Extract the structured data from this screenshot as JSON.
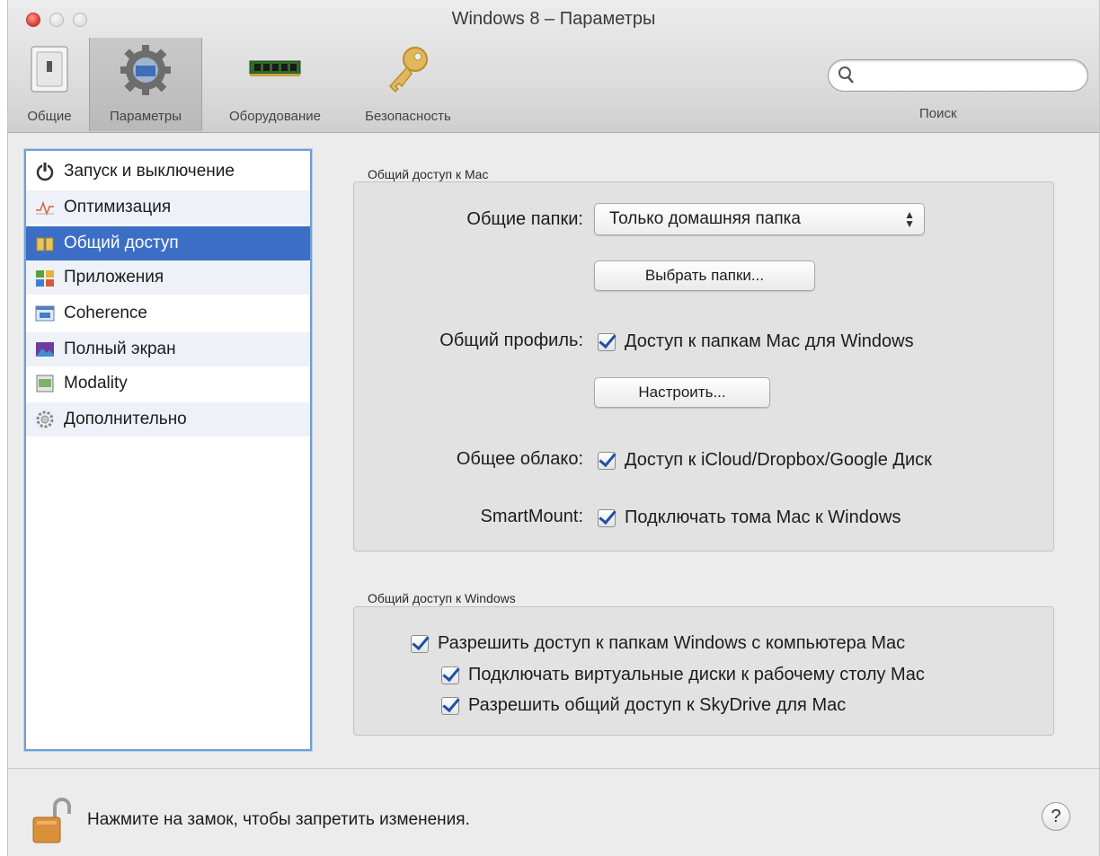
{
  "window": {
    "title": "Windows 8 – Параметры"
  },
  "toolbar": {
    "items": [
      {
        "label": "Общие",
        "icon": "general-switch-icon"
      },
      {
        "label": "Параметры",
        "icon": "gear-icon",
        "selected": true
      },
      {
        "label": "Оборудование",
        "icon": "memory-chip-icon"
      },
      {
        "label": "Безопасность",
        "icon": "key-icon"
      }
    ],
    "search": {
      "label": "Поиск",
      "placeholder": "",
      "value": ""
    }
  },
  "sidebar": {
    "items": [
      {
        "label": "Запуск и выключение",
        "icon": "power-icon"
      },
      {
        "label": "Оптимизация",
        "icon": "optimization-icon"
      },
      {
        "label": "Общий доступ",
        "icon": "sharing-icon",
        "selected": true
      },
      {
        "label": "Приложения",
        "icon": "applications-icon"
      },
      {
        "label": "Coherence",
        "icon": "coherence-icon"
      },
      {
        "label": "Полный экран",
        "icon": "fullscreen-icon"
      },
      {
        "label": "Modality",
        "icon": "modality-icon"
      },
      {
        "label": "Дополнительно",
        "icon": "advanced-gear-icon"
      }
    ]
  },
  "mac_sharing": {
    "title": "Общий доступ к Mac",
    "shared_folders_label": "Общие папки:",
    "shared_folders_value": "Только домашняя папка",
    "choose_folders_button": "Выбрать папки...",
    "shared_profile_label": "Общий профиль:",
    "shared_profile_checkbox": "Доступ к папкам Mac для Windows",
    "shared_profile_checked": true,
    "configure_button": "Настроить...",
    "shared_cloud_label": "Общее облако:",
    "shared_cloud_checkbox": "Доступ к iCloud/Dropbox/Google Диск",
    "shared_cloud_checked": true,
    "smartmount_label": "SmartMount:",
    "smartmount_checkbox": "Подключать тома Mac к Windows",
    "smartmount_checked": true
  },
  "windows_sharing": {
    "title": "Общий доступ к Windows",
    "allow_access": "Разрешить доступ к папкам Windows с компьютера Mac",
    "allow_access_checked": true,
    "mount_virtual_disks": "Подключать виртуальные диски к рабочему столу Mac",
    "mount_virtual_disks_checked": true,
    "share_skydrive": "Разрешить общий доступ к SkyDrive для Mac",
    "share_skydrive_checked": true
  },
  "footer": {
    "lock_text": "Нажмите на замок, чтобы запретить изменения.",
    "help_label": "?"
  },
  "colors": {
    "selection_blue": "#3d6ec6",
    "sidebar_border": "#6f9fd6",
    "checkmark": "#1f4fa8"
  }
}
